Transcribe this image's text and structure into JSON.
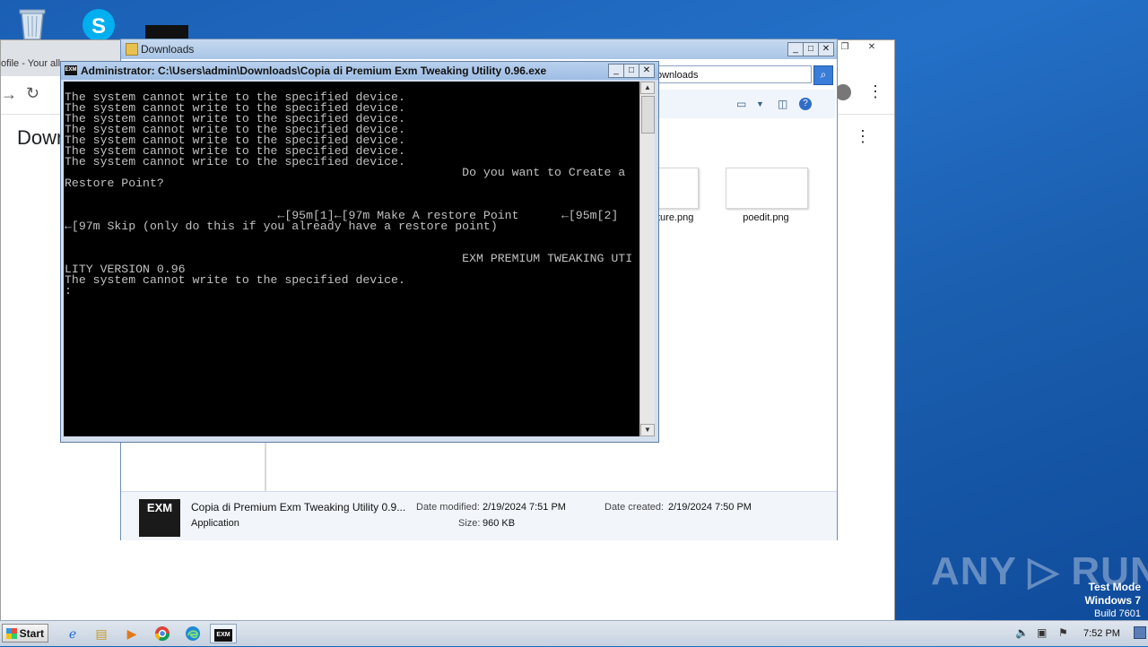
{
  "desktop": {
    "icons": [
      "recycle-bin",
      "skype",
      "command-prompt"
    ]
  },
  "browser": {
    "tab_title": "ofile - Your all",
    "page_heading": "Down",
    "controls": {
      "minimize": "—",
      "maximize": "❐",
      "close": "✕"
    }
  },
  "explorer": {
    "title": "Downloads",
    "address_fragment": "ownloads",
    "files": [
      {
        "name": "ture.png"
      },
      {
        "name": "poedit.png"
      }
    ],
    "details": {
      "file_name": "Copia di Premium Exm Tweaking Utility 0.9...",
      "file_type": "Application",
      "date_modified_label": "Date modified:",
      "date_modified": "2/19/2024 7:51 PM",
      "size_label": "Size:",
      "size": "960 KB",
      "date_created_label": "Date created:",
      "date_created": "2/19/2024 7:50 PM",
      "thumb_text": "EXM"
    }
  },
  "console": {
    "title": "Administrator:  C:\\Users\\admin\\Downloads\\Copia di Premium Exm Tweaking Utility 0.96.exe",
    "icon_text": "EXM",
    "output": "\nThe system cannot write to the specified device.\nThe system cannot write to the specified device.\nThe system cannot write to the specified device.\nThe system cannot write to the specified device.\nThe system cannot write to the specified device.\nThe system cannot write to the specified device.\nThe system cannot write to the specified device.\n                                                        Do you want to Create a\nRestore Point?\n\n\n                              ←[95m[1]←[97m Make A restore Point      ←[95m[2]\n←[97m Skip (only do this if you already have a restore point)\n\n\n                                                        EXM PREMIUM TWEAKING UTI\nLITY VERSION 0.96\nThe system cannot write to the specified device.\n:"
  },
  "watermark": {
    "text": "ANY ▷ RUN",
    "mode": "Test Mode",
    "os": "Windows 7",
    "build": "Build 7601"
  },
  "taskbar": {
    "start_label": "Start",
    "apps": [
      "internet-explorer",
      "explorer",
      "media-player",
      "chrome",
      "edge",
      "exm-console"
    ],
    "active_app_text": "EXM",
    "clock": "7:52 PM"
  }
}
